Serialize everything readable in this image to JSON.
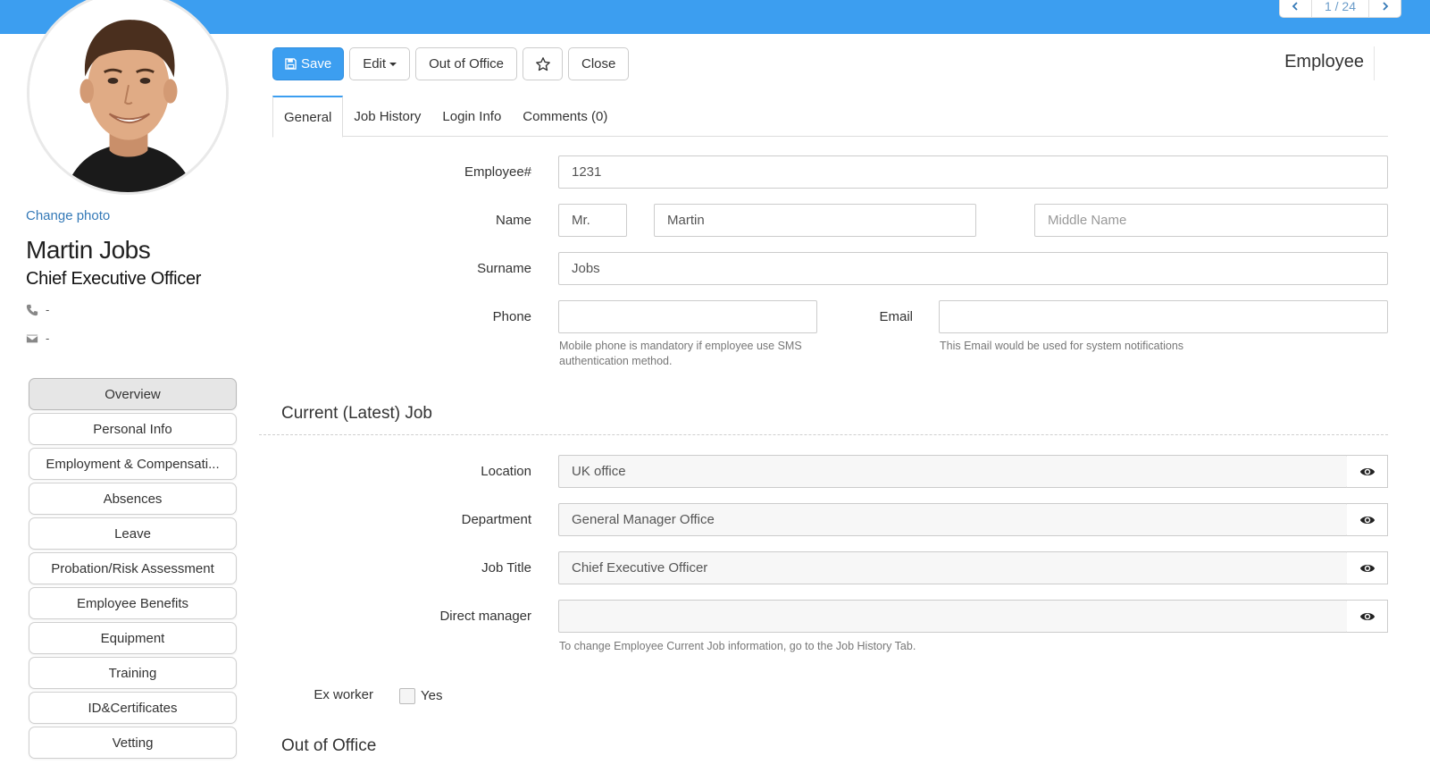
{
  "pager": {
    "text": "1 / 24"
  },
  "profile": {
    "change_photo": "Change photo",
    "name": "Martin Jobs",
    "title": "Chief Executive Officer",
    "phone": "-",
    "email": "-"
  },
  "side_menu": [
    {
      "label": "Overview",
      "active": true
    },
    {
      "label": "Personal Info"
    },
    {
      "label": "Employment & Compensati..."
    },
    {
      "label": "Absences"
    },
    {
      "label": "Leave"
    },
    {
      "label": "Probation/Risk Assessment"
    },
    {
      "label": "Employee Benefits"
    },
    {
      "label": "Equipment"
    },
    {
      "label": "Training"
    },
    {
      "label": "ID&Certificates"
    },
    {
      "label": "Vetting"
    }
  ],
  "toolbar": {
    "save": "Save",
    "edit": "Edit",
    "out_of_office": "Out of Office",
    "close": "Close"
  },
  "page_label": "Employee",
  "tabs": [
    {
      "label": "General",
      "active": true
    },
    {
      "label": "Job History"
    },
    {
      "label": "Login Info"
    },
    {
      "label": "Comments (0)"
    }
  ],
  "form": {
    "employee_no": {
      "label": "Employee#",
      "value": "1231"
    },
    "name": {
      "label": "Name",
      "prefix": "Mr.",
      "first": "Martin",
      "middle_placeholder": "Middle Name"
    },
    "surname": {
      "label": "Surname",
      "value": "Jobs"
    },
    "phone": {
      "label": "Phone",
      "value": "",
      "help": "Mobile phone is mandatory if employee use SMS authentication method."
    },
    "email": {
      "label": "Email",
      "value": "",
      "help": "This Email would be used for system notifications"
    }
  },
  "current_job": {
    "section_title": "Current (Latest) Job",
    "location": {
      "label": "Location",
      "value": "UK office"
    },
    "department": {
      "label": "Department",
      "value": "General Manager Office"
    },
    "job_title": {
      "label": "Job Title",
      "value": "Chief Executive Officer"
    },
    "direct_manager": {
      "label": "Direct manager",
      "value": ""
    },
    "help": "To change Employee Current Job information, go to the Job History Tab."
  },
  "ex_worker": {
    "label": "Ex worker",
    "option": "Yes"
  },
  "out_of_office_section": "Out of Office",
  "colors": {
    "accent": "#3c9ef0",
    "link": "#3479b7"
  }
}
